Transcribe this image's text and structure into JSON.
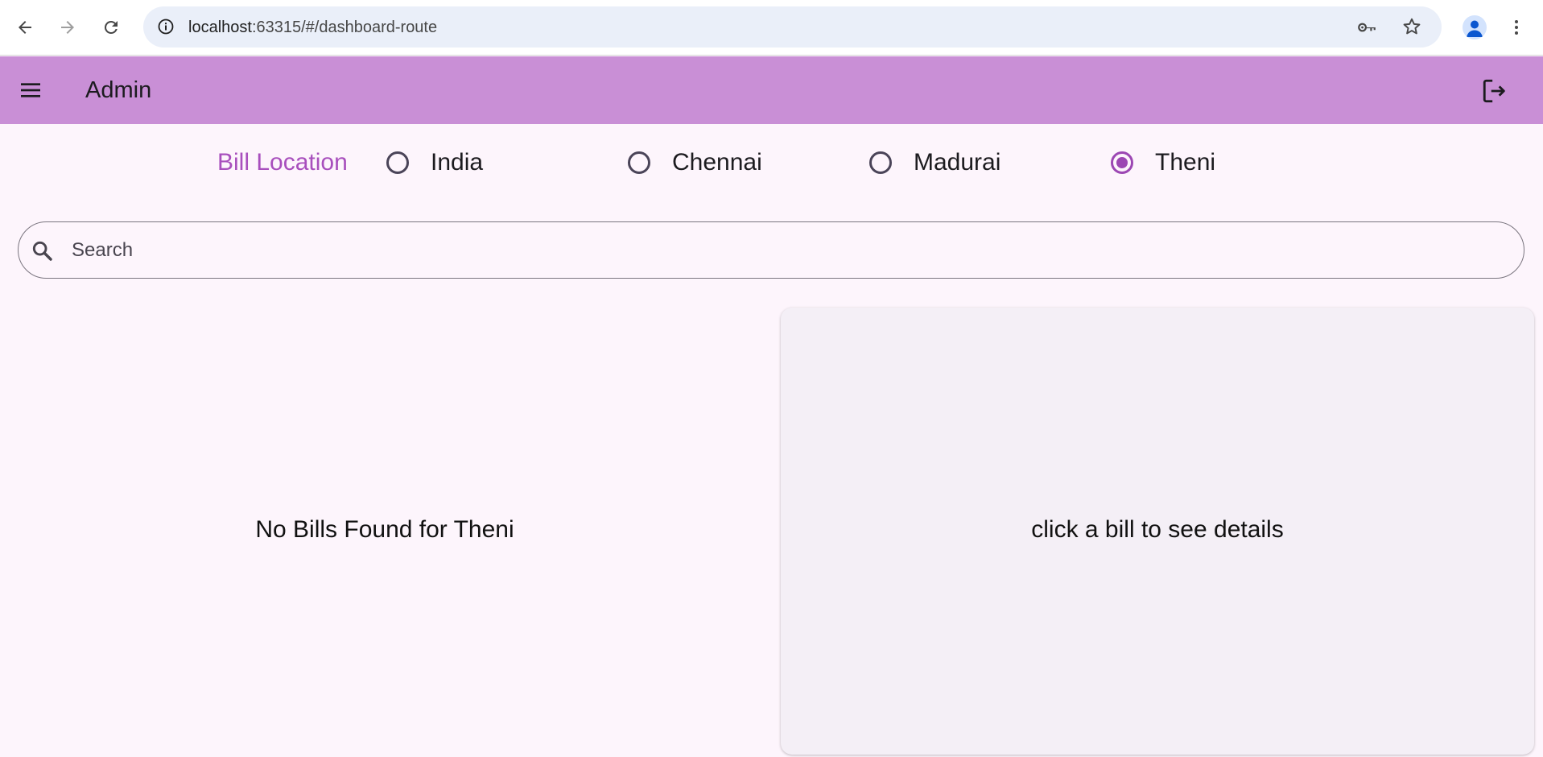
{
  "browser": {
    "url_host": "localhost",
    "url_path": ":63315/#/dashboard-route"
  },
  "app_bar": {
    "title": "Admin"
  },
  "bill_location": {
    "label": "Bill Location",
    "options": [
      {
        "label": "India",
        "checked": false
      },
      {
        "label": "Chennai",
        "checked": false
      },
      {
        "label": "Madurai",
        "checked": false
      },
      {
        "label": "Theni",
        "checked": true
      }
    ],
    "selected": "Theni"
  },
  "search": {
    "placeholder": "Search",
    "value": ""
  },
  "bills_pane": {
    "empty_message": "No Bills Found for Theni"
  },
  "detail_pane": {
    "message": "click a bill to see details"
  },
  "colors": {
    "app_bar": "#c98fd6",
    "accent": "#9c47b3",
    "label": "#a84fbd",
    "page_bg": "#fdf5fc",
    "detail_bg": "#f4eff6"
  },
  "icons": [
    "back-arrow-icon",
    "forward-arrow-icon",
    "reload-icon",
    "site-info-icon",
    "password-key-icon",
    "bookmark-star-icon",
    "profile-avatar-icon",
    "more-vert-icon",
    "menu-icon",
    "logout-icon",
    "search-icon"
  ]
}
